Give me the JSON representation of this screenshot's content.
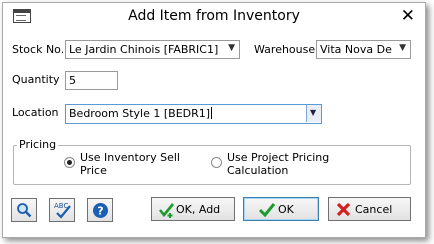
{
  "window": {
    "title": "Add Item from Inventory"
  },
  "form": {
    "stock_no_label": "Stock No.",
    "stock_no_value": "Le Jardin Chinois [FABRIC1]",
    "warehouse_label": "Warehouse",
    "warehouse_value": "Vita Nova De",
    "quantity_label": "Quantity",
    "quantity_value": "5",
    "location_label": "Location",
    "location_value": "Bedroom Style 1 [BEDR1]"
  },
  "pricing": {
    "group_label": "Pricing",
    "option1_line1": "Use Inventory Sell",
    "option1_line2": "Price",
    "option2_line1": "Use Project Pricing",
    "option2_line2": "Calculation",
    "selected": "inventory-sell-price"
  },
  "buttons": {
    "ok_add": "OK, Add",
    "ok": "OK",
    "cancel": "Cancel"
  },
  "icons": {
    "search": "magnifier-icon",
    "spellcheck": "spellcheck-icon",
    "help": "help-icon"
  },
  "colors": {
    "help_blue": "#1a5fb4",
    "ok_green": "#1f9a2e",
    "cancel_red": "#d42020"
  }
}
